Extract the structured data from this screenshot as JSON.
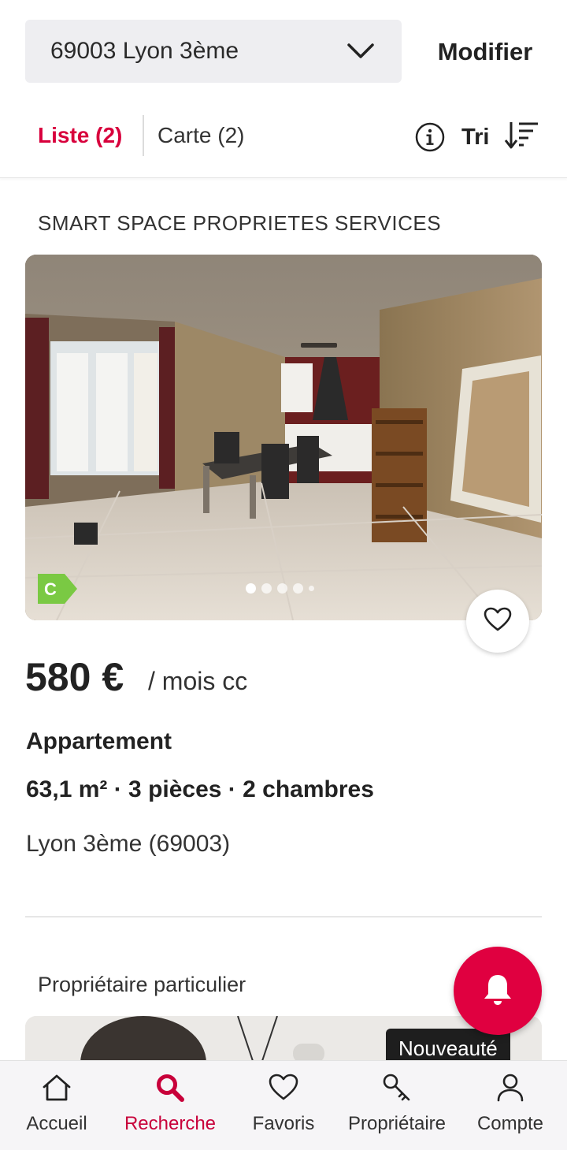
{
  "search": {
    "location": "69003 Lyon 3ème",
    "modify_label": "Modifier"
  },
  "tabs": {
    "list_label": "Liste (2)",
    "map_label": "Carte (2)",
    "sort_label": "Tri"
  },
  "listings": [
    {
      "advertiser": "SMART SPACE PROPRIETES SERVICES",
      "energy_class": "C",
      "photo_count": 5,
      "active_photo": 1,
      "price": "580 €",
      "price_unit": "/ mois cc",
      "type": "Appartement",
      "details": "63,1 m² · 3 pièces · 2 chambres",
      "location": "Lyon 3ème (69003)"
    },
    {
      "advertiser": "Propriétaire particulier",
      "badge": "Nouveauté"
    }
  ],
  "bottom_nav": [
    {
      "label": "Accueil",
      "icon": "home-icon",
      "active": false
    },
    {
      "label": "Recherche",
      "icon": "search-icon",
      "active": true
    },
    {
      "label": "Favoris",
      "icon": "heart-icon",
      "active": false
    },
    {
      "label": "Propriétaire",
      "icon": "key-icon",
      "active": false
    },
    {
      "label": "Compte",
      "icon": "user-icon",
      "active": false
    }
  ],
  "colors": {
    "accent": "#d8003c",
    "alert_button": "#e00040",
    "energy_c": "#7ac943",
    "nav_background": "#f6f5f7"
  }
}
